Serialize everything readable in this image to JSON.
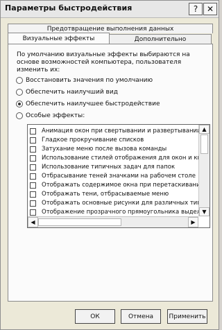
{
  "window": {
    "title": "Параметры быстродействия",
    "help_glyph": "?",
    "close_glyph": "✕"
  },
  "tabs": {
    "top": "Предотвращение выполнения данных",
    "active": "Визуальные эффекты",
    "inactive": "Дополнительно"
  },
  "panel": {
    "description": "По умолчанию визуальные эффекты выбираются на основе возможностей компьютера, пользователя изменить их:",
    "radio_options": [
      {
        "label": "Восстановить значения по умолчанию",
        "selected": false
      },
      {
        "label": "Обеспечить наилучший вид",
        "selected": false
      },
      {
        "label": "Обеспечить наилучшее быстродействие",
        "selected": true
      },
      {
        "label": "Особые эффекты:",
        "selected": false
      }
    ],
    "effects": [
      "Анимация окон при свертывании и развертывании",
      "Гладкое прокручивание списков",
      "Затухание меню после вызова команды",
      "Использование стилей отображения для окон и кнопок",
      "Использование типичных задач для папок",
      "Отбрасывание теней значками на рабочем столе",
      "Отображать содержимое окна при перетаскивании",
      "Отображать тени, отбрасываемые меню",
      "Отображать основные рисунки для различных типов",
      "Отображение прозрачного прямоугольника выделения"
    ]
  },
  "buttons": {
    "ok": "ОК",
    "cancel": "Отмена",
    "apply": "Применить"
  }
}
